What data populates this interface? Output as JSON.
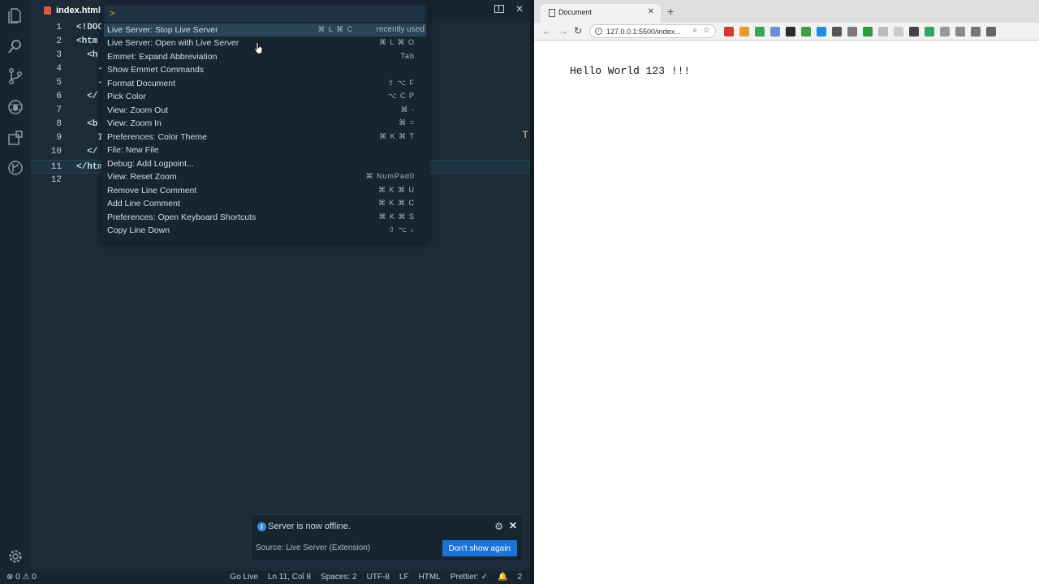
{
  "editor": {
    "tab_label": "index.html",
    "lines": [
      {
        "no": "1",
        "code": "<!DOC"
      },
      {
        "no": "2",
        "code": "<htm"
      },
      {
        "no": "3",
        "code": "  <h"
      },
      {
        "no": "4",
        "code": "    -"
      },
      {
        "no": "5",
        "code": "    -"
      },
      {
        "no": "6",
        "code": "  </"
      },
      {
        "no": "7",
        "code": ""
      },
      {
        "no": "8",
        "code": "  <b"
      },
      {
        "no": "9",
        "code": "    I"
      },
      {
        "no": "10",
        "code": "  </"
      },
      {
        "no": "11",
        "code": "</htm"
      },
      {
        "no": "12",
        "code": ""
      }
    ],
    "scroll_mark": "T"
  },
  "palette": {
    "input_value": ">",
    "commands": [
      {
        "label": "Live Server: Stop Live Server",
        "keys": "⌘ L ⌘ C",
        "tag": "recently used"
      },
      {
        "label": "Live Server: Open with Live Server",
        "keys": "⌘ L ⌘ O",
        "tag": ""
      },
      {
        "label": "Emmet: Expand Abbreviation",
        "keys": "Tab",
        "tag": ""
      },
      {
        "label": "Show Emmet Commands",
        "keys": "",
        "tag": ""
      },
      {
        "label": "Format Document",
        "keys": "⇧ ⌥ F",
        "tag": ""
      },
      {
        "label": "Pick Color",
        "keys": "⌥ C P",
        "tag": ""
      },
      {
        "label": "View: Zoom Out",
        "keys": "⌘ -",
        "tag": ""
      },
      {
        "label": "View: Zoom In",
        "keys": "⌘ =",
        "tag": ""
      },
      {
        "label": "Preferences: Color Theme",
        "keys": "⌘ K ⌘ T",
        "tag": ""
      },
      {
        "label": "File: New File",
        "keys": "",
        "tag": ""
      },
      {
        "label": "Debug: Add Logpoint...",
        "keys": "",
        "tag": ""
      },
      {
        "label": "View: Reset Zoom",
        "keys": "⌘ NumPad0",
        "tag": ""
      },
      {
        "label": "Remove Line Comment",
        "keys": "⌘ K ⌘ U",
        "tag": ""
      },
      {
        "label": "Add Line Comment",
        "keys": "⌘ K ⌘ C",
        "tag": ""
      },
      {
        "label": "Preferences: Open Keyboard Shortcuts",
        "keys": "⌘ K ⌘ S",
        "tag": ""
      },
      {
        "label": "Copy Line Down",
        "keys": "⇧ ⌥ ↓",
        "tag": ""
      }
    ]
  },
  "notification": {
    "message": "Server is now offline.",
    "source": "Source: Live Server (Extension)",
    "button": "Don't show again"
  },
  "statusbar": {
    "problems": "⊗ 0 ⚠ 0",
    "golive": "Go Live",
    "position": "Ln 11, Col 8",
    "spaces": "Spaces: 2",
    "encoding": "UTF-8",
    "eol": "LF",
    "language": "HTML",
    "prettier": "Prettier: ✓",
    "notifications": "2"
  },
  "browser": {
    "tab_title": "Document",
    "url": "127.0.0.1:5500/index...",
    "page_text": "Hello World 123 !!!",
    "extension_colors": [
      "#d23b2b",
      "#e89a2a",
      "#3aa655",
      "#6b8fd8",
      "#2b2b2b",
      "#40a047",
      "#1f8ce6",
      "#555555",
      "#7a7a7a",
      "#2f9d3c",
      "#bbbbbb",
      "#cccccc",
      "#444444",
      "#39a36b",
      "#999999",
      "#888888",
      "#777777",
      "#666666"
    ]
  }
}
